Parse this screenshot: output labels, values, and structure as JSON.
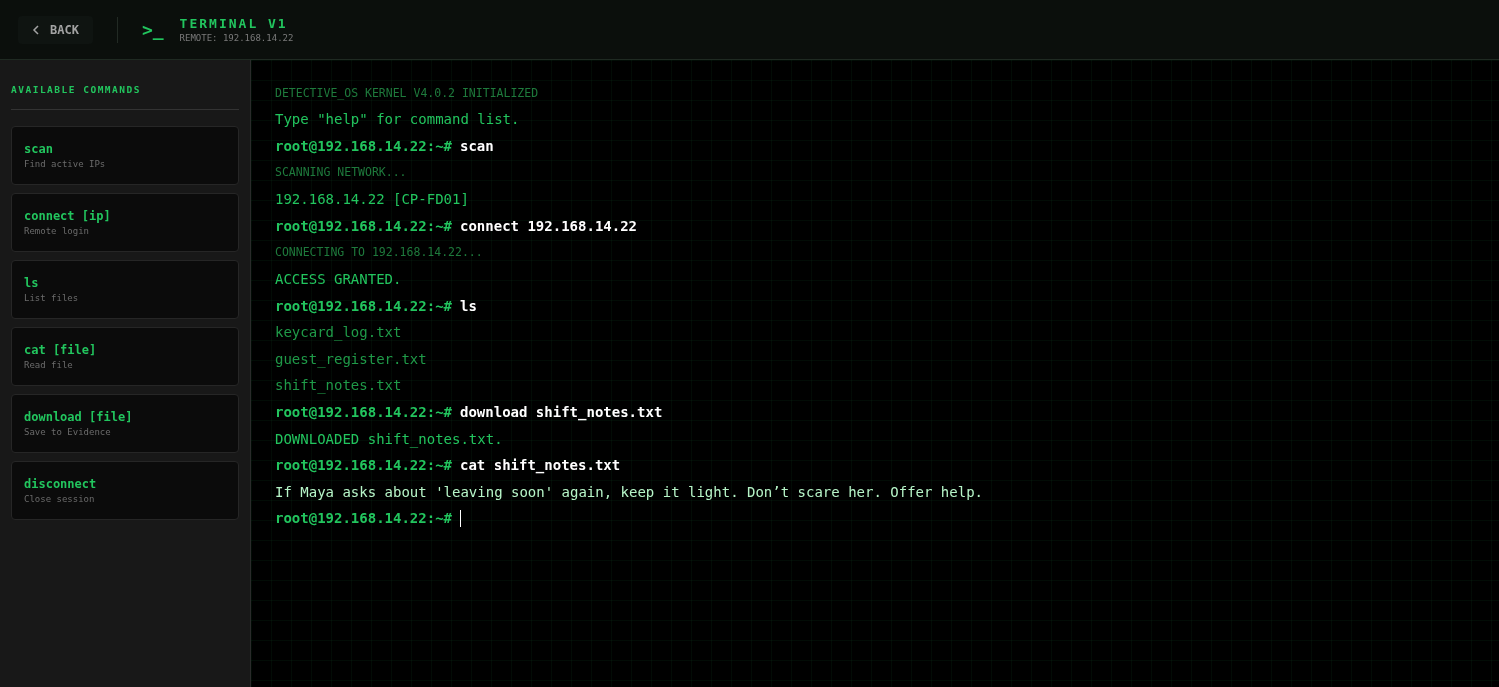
{
  "header": {
    "back_label": "BACK",
    "prompt_glyph": ">_",
    "title": "TERMINAL V1",
    "subtitle": "REMOTE: 192.168.14.22"
  },
  "sidebar": {
    "heading": "AVAILABLE COMMANDS",
    "commands": [
      {
        "name": "scan",
        "description": "Find active IPs"
      },
      {
        "name": "connect [ip]",
        "description": "Remote login"
      },
      {
        "name": "ls",
        "description": "List files"
      },
      {
        "name": "cat [file]",
        "description": "Read file"
      },
      {
        "name": "download [file]",
        "description": "Save to Evidence"
      },
      {
        "name": "disconnect",
        "description": "Close session"
      }
    ]
  },
  "terminal": {
    "lines": [
      {
        "kind": "system",
        "text": "DETECTIVE_OS KERNEL V4.0.2 INITIALIZED"
      },
      {
        "kind": "info",
        "text": "Type \"help\" for command list."
      },
      {
        "kind": "command",
        "prompt": "root@192.168.14.22:~#",
        "text": "scan"
      },
      {
        "kind": "system",
        "text": "SCANNING NETWORK..."
      },
      {
        "kind": "info",
        "text": "192.168.14.22 [CP-FD01]"
      },
      {
        "kind": "command",
        "prompt": "root@192.168.14.22:~#",
        "text": "connect 192.168.14.22"
      },
      {
        "kind": "system",
        "text": "CONNECTING TO 192.168.14.22..."
      },
      {
        "kind": "info",
        "text": "ACCESS GRANTED."
      },
      {
        "kind": "command",
        "prompt": "root@192.168.14.22:~#",
        "text": "ls"
      },
      {
        "kind": "file",
        "text": "keycard_log.txt"
      },
      {
        "kind": "file",
        "text": "guest_register.txt"
      },
      {
        "kind": "file",
        "text": "shift_notes.txt"
      },
      {
        "kind": "command",
        "prompt": "root@192.168.14.22:~#",
        "text": "download shift_notes.txt"
      },
      {
        "kind": "info",
        "text": "DOWNLOADED shift_notes.txt."
      },
      {
        "kind": "command",
        "prompt": "root@192.168.14.22:~#",
        "text": "cat shift_notes.txt"
      },
      {
        "kind": "output",
        "text": "If Maya asks about 'leaving soon' again, keep it light. Don’t scare her. Offer help."
      }
    ],
    "input": {
      "prompt": "root@192.168.14.22:~#"
    }
  }
}
